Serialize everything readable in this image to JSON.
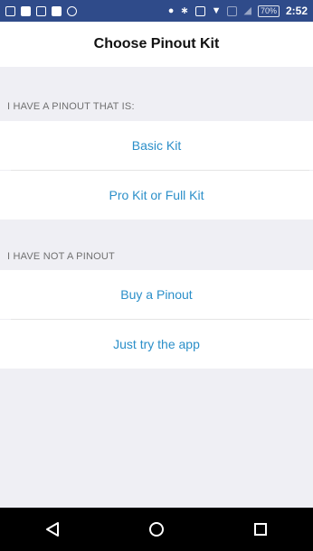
{
  "status_bar": {
    "time": "2:52",
    "battery": "70%",
    "icons": [
      "sim-icon",
      "facebook-icon",
      "message-icon",
      "gallery-icon",
      "block-icon",
      "location-icon",
      "bluetooth-icon",
      "nfc-icon",
      "wifi-icon",
      "signal-icon",
      "no-signal-icon",
      "battery-icon"
    ]
  },
  "header": {
    "title": "Choose Pinout Kit"
  },
  "sections": [
    {
      "header": "I HAVE A PINOUT THAT IS:",
      "items": [
        {
          "label": "Basic Kit"
        },
        {
          "label": "Pro Kit or Full Kit"
        }
      ]
    },
    {
      "header": "I HAVE NOT A PINOUT",
      "items": [
        {
          "label": "Buy a Pinout"
        },
        {
          "label": "Just try the app"
        }
      ]
    }
  ],
  "navigation_bar": {
    "buttons": [
      "back-icon",
      "home-icon",
      "recents-icon"
    ]
  },
  "colors": {
    "status_bar": "#2f4b8a",
    "accent_text": "#2b8fc9",
    "background": "#efeff4",
    "nav_bar": "#000000"
  }
}
